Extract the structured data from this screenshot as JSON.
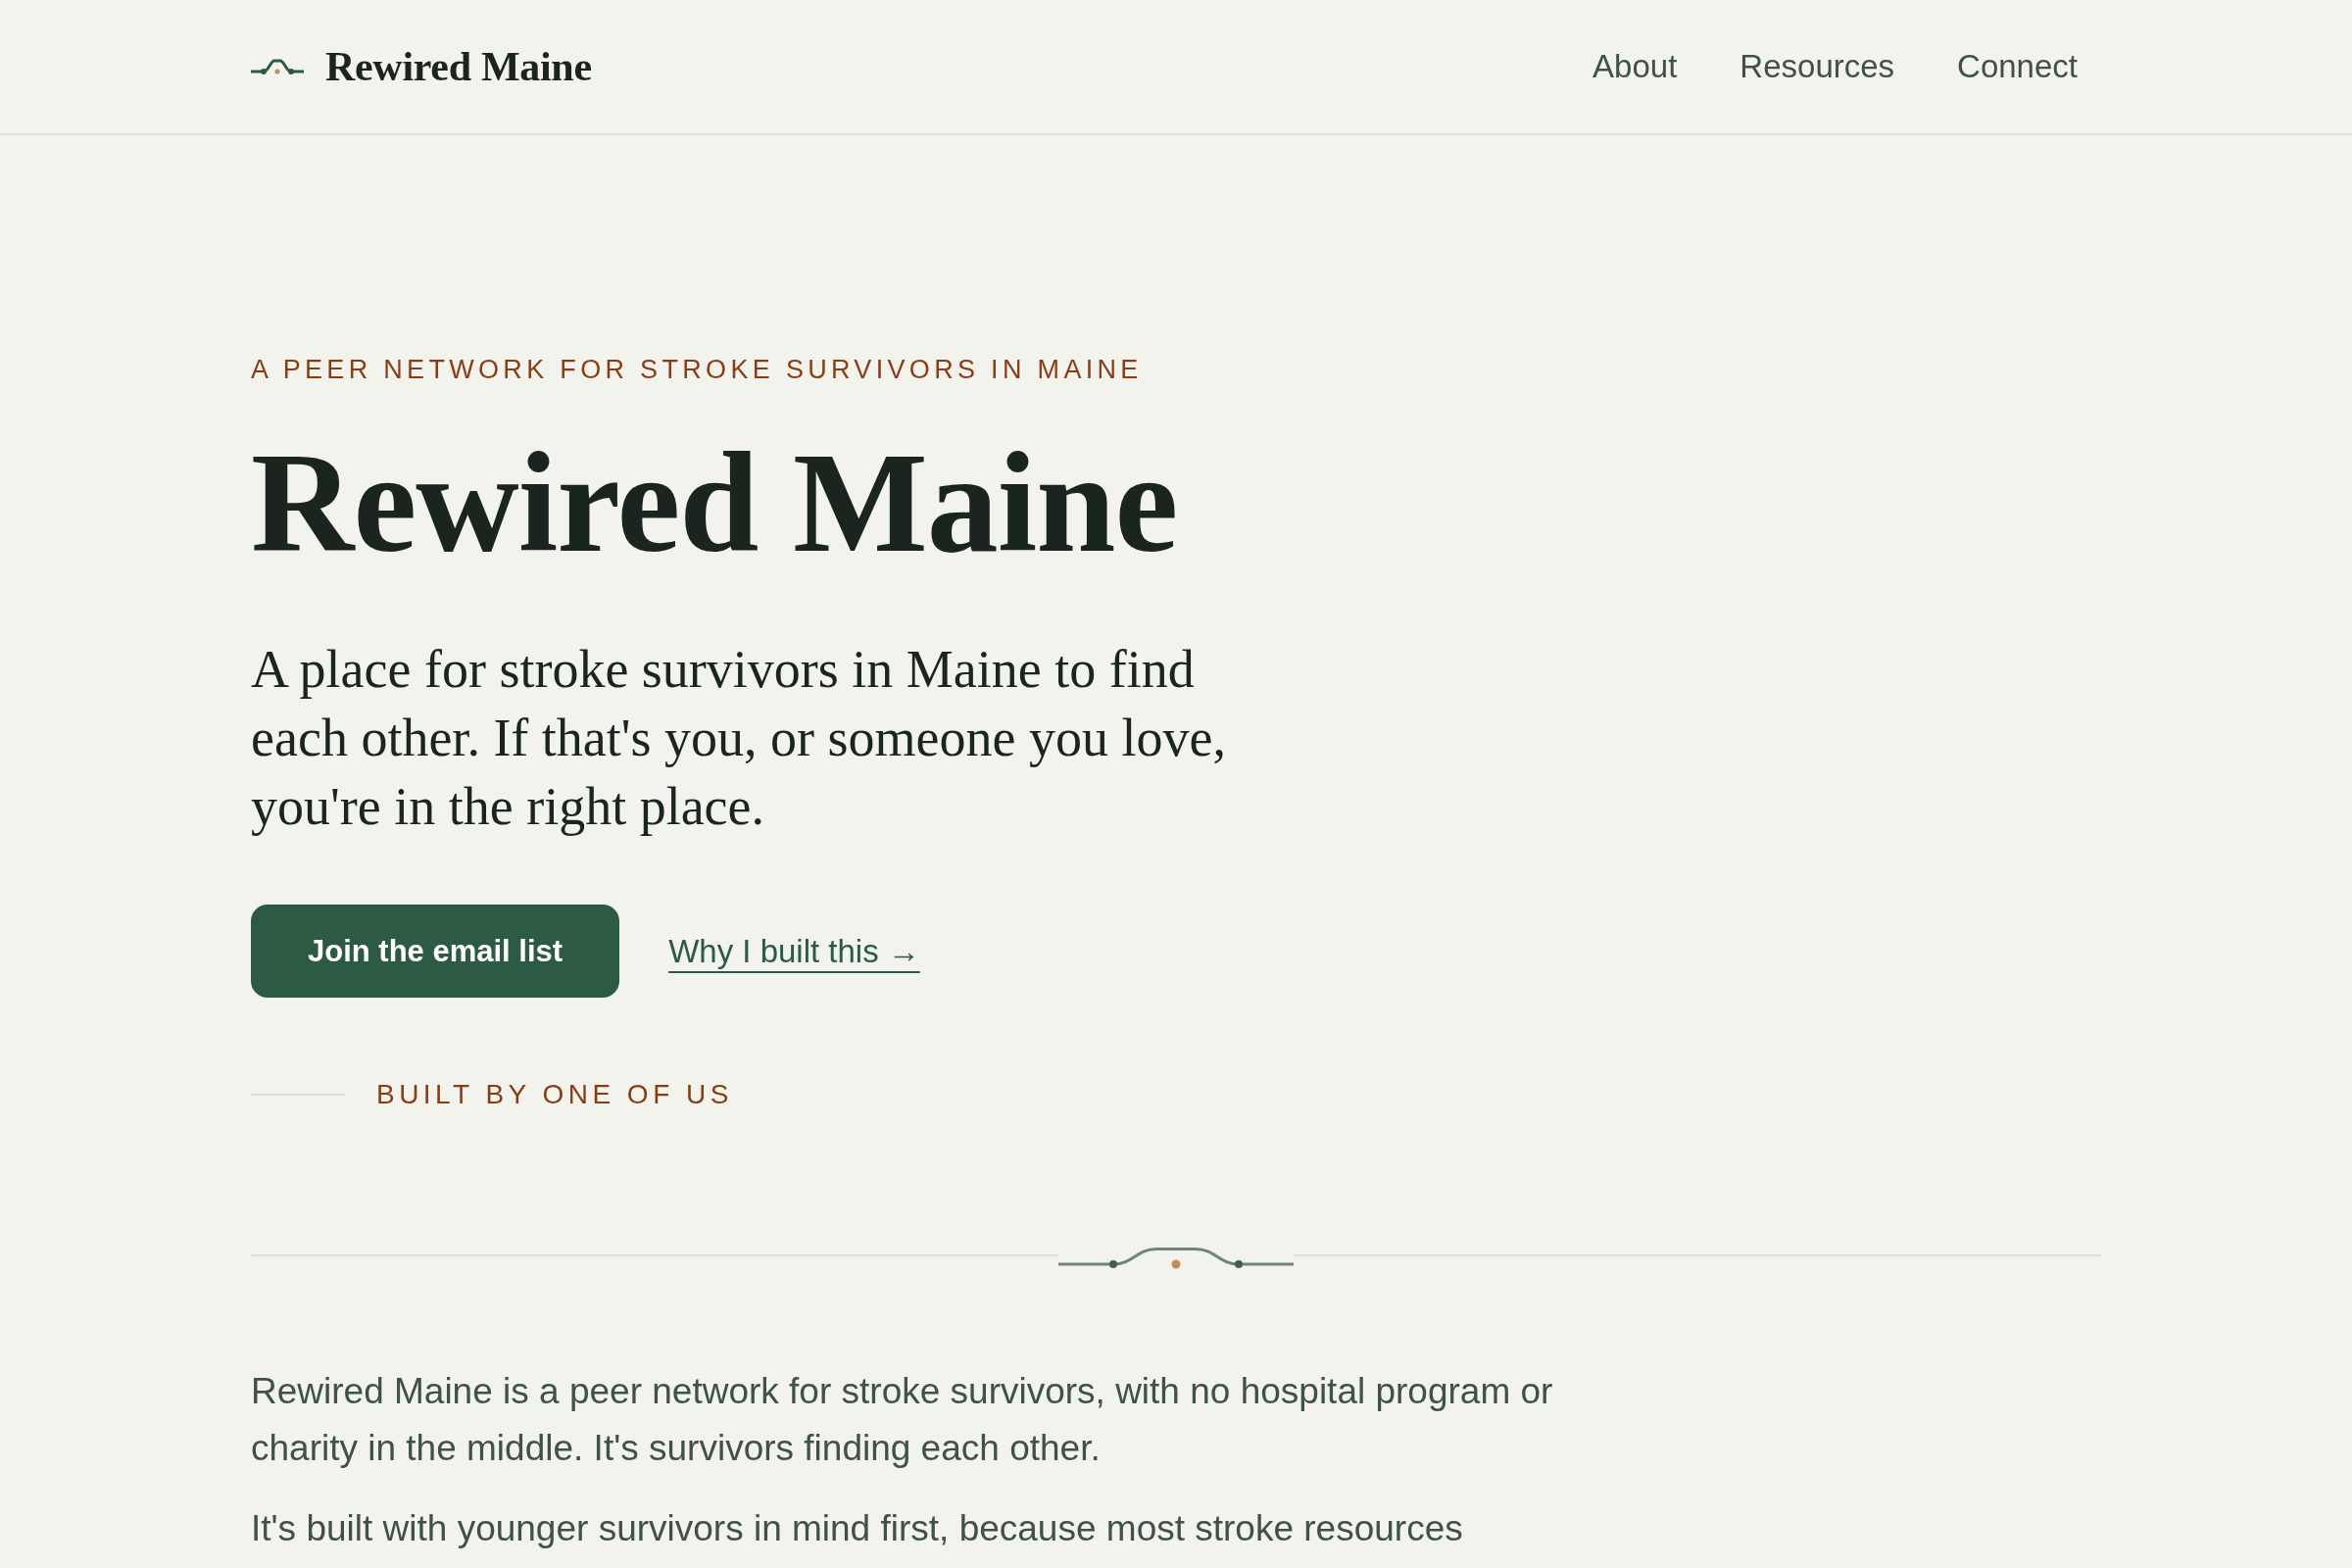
{
  "header": {
    "logo": "Rewired Maine",
    "nav": [
      "About",
      "Resources",
      "Connect"
    ]
  },
  "hero": {
    "eyebrow": "A PEER NETWORK FOR STROKE SURVIVORS IN MAINE",
    "title": "Rewired Maine",
    "lead": "A place for stroke survivors in Maine to find each other. If that's you, or someone you love, you're in the right place.",
    "primary_button": "Join the email list",
    "secondary_link": "Why I built this →",
    "byline": "BUILT BY ONE OF US"
  },
  "intro": {
    "paragraphs": [
      "Rewired Maine is a peer network for stroke survivors, with no hospital program or charity in the middle. It's survivors finding each other.",
      "It's built with younger survivors in mind first, because most stroke resources"
    ]
  }
}
